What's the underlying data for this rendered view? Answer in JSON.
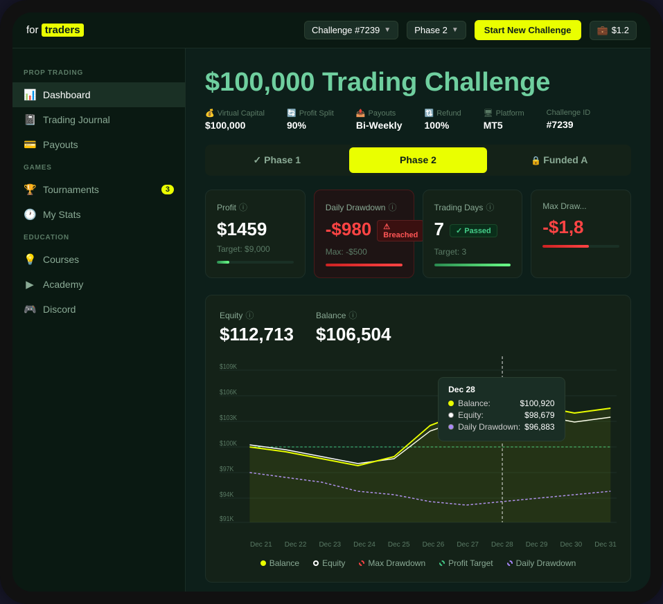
{
  "app": {
    "logo_for": "for",
    "logo_traders": "traders"
  },
  "topbar": {
    "challenge_label": "Challenge #7239",
    "phase_label": "Phase 2",
    "start_btn": "Start New Challenge",
    "wallet_amount": "$1.2"
  },
  "sidebar": {
    "prop_trading_label": "PROP TRADING",
    "games_label": "GAMES",
    "education_label": "EDUCATION",
    "items": [
      {
        "id": "dashboard",
        "label": "Dashboard",
        "active": true
      },
      {
        "id": "trading-journal",
        "label": "Trading Journal",
        "active": false
      },
      {
        "id": "payouts",
        "label": "Payouts",
        "active": false
      }
    ],
    "games_items": [
      {
        "id": "tournaments",
        "label": "Tournaments",
        "badge": "3"
      },
      {
        "id": "my-stats",
        "label": "My Stats"
      }
    ],
    "education_items": [
      {
        "id": "courses",
        "label": "Courses"
      },
      {
        "id": "academy",
        "label": "Academy"
      },
      {
        "id": "discord",
        "label": "Discord"
      }
    ]
  },
  "page": {
    "title_dollar": "$100,000",
    "title_rest": " Trading Challenge",
    "stats": [
      {
        "label": "Virtual Capital",
        "icon": "💰",
        "value": "$100,000"
      },
      {
        "label": "Profit Split",
        "icon": "🔄",
        "value": "90%"
      },
      {
        "label": "Payouts",
        "icon": "📤",
        "value": "Bi-Weekly"
      },
      {
        "label": "Refund",
        "icon": "🔃",
        "value": "100%"
      },
      {
        "label": "Platform",
        "icon": "🖥",
        "value": "MT5"
      },
      {
        "label": "Challenge ID",
        "icon": "",
        "value": "#7239"
      }
    ],
    "tabs": [
      {
        "id": "phase1",
        "label": "Phase 1",
        "type": "check",
        "active": false
      },
      {
        "id": "phase2",
        "label": "Phase 2",
        "type": "normal",
        "active": true
      },
      {
        "id": "funded",
        "label": "Funded A",
        "type": "lock",
        "active": false
      }
    ],
    "metrics": [
      {
        "id": "profit",
        "label": "Profit",
        "value": "$1459",
        "badge": null,
        "footer": "Target: $9,000",
        "progress": 16,
        "progress_type": "green",
        "card_type": "normal"
      },
      {
        "id": "daily-drawdown",
        "label": "Daily Drawdown",
        "value": "-$980",
        "badge_text": "⚠ Breached",
        "badge_type": "breach",
        "footer": "Max: -$500",
        "progress": 100,
        "progress_type": "red",
        "card_type": "danger"
      },
      {
        "id": "trading-days",
        "label": "Trading Days",
        "value": "7",
        "badge_text": "✓ Passed",
        "badge_type": "passed",
        "footer": "Target: 3",
        "progress": 100,
        "progress_type": "green",
        "card_type": "normal"
      },
      {
        "id": "max-drawdown",
        "label": "Max Drawdown",
        "value": "-$1,8",
        "badge": null,
        "footer": "",
        "progress": 60,
        "progress_type": "red",
        "card_type": "normal"
      }
    ],
    "chart": {
      "equity_label": "Equity",
      "equity_value": "$112,713",
      "balance_label": "Balance",
      "balance_value": "$106,504",
      "tooltip": {
        "date": "Dec 28",
        "balance_label": "Balance:",
        "balance_value": "$100,920",
        "equity_label": "Equity:",
        "equity_value": "$98,679",
        "drawdown_label": "Daily Drawdown:",
        "drawdown_value": "$96,883"
      },
      "x_labels": [
        "Dec 21",
        "Dec 22",
        "Dec 23",
        "Dec 24",
        "Dec 25",
        "Dec 26",
        "Dec 27",
        "Dec 28",
        "Dec 29",
        "Dec 30",
        "Dec 31"
      ],
      "y_labels": [
        "$109K",
        "$106K",
        "$103K",
        "$100K",
        "$97K",
        "$94K",
        "$91K"
      ],
      "legend": [
        {
          "id": "balance",
          "label": "Balance",
          "type": "yellow"
        },
        {
          "id": "equity",
          "label": "Equity",
          "type": "white"
        },
        {
          "id": "max-drawdown",
          "label": "Max Drawdown",
          "type": "red"
        },
        {
          "id": "profit-target",
          "label": "Profit Target",
          "type": "green"
        },
        {
          "id": "daily-drawdown",
          "label": "Daily Drawdown",
          "type": "purple"
        }
      ]
    }
  }
}
